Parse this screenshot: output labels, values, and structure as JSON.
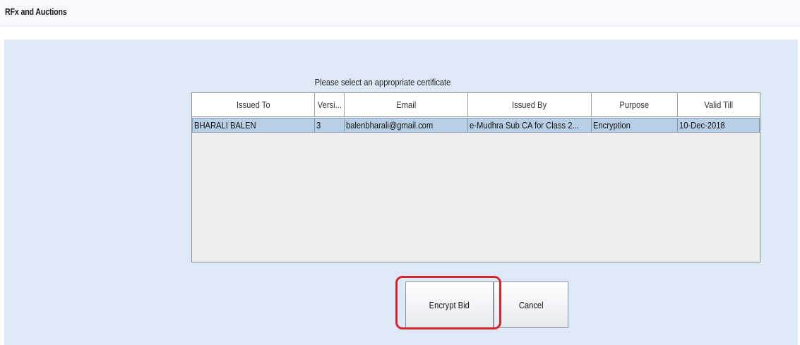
{
  "header": {
    "title": "RFx and Auctions"
  },
  "dialog": {
    "heading": "Please select an appropriate certificate",
    "columns": [
      "Issued To",
      "Versi...",
      "Email",
      "Issued By",
      "Purpose",
      "Valid Till"
    ],
    "rows": [
      [
        "BHARALI BALEN",
        "3",
        "balenbharali@gmail.com",
        "e-Mudhra Sub CA for Class 2...",
        "Encryption",
        "10-Dec-2018"
      ]
    ],
    "encrypt_label": "Encrypt Bid",
    "cancel_label": "Cancel"
  },
  "colors": {
    "panel": "#dde9f7",
    "selected_row": "#b8cfe5",
    "highlight": "#d7262e"
  }
}
